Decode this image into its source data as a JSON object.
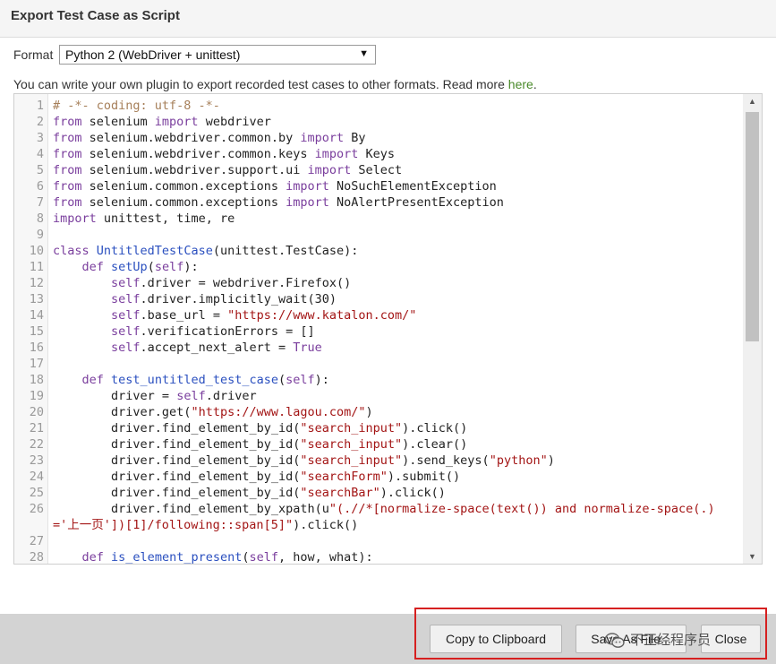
{
  "window": {
    "title": "Export Test Case as Script"
  },
  "format": {
    "label": "Format",
    "selected": "Python 2 (WebDriver + unittest)"
  },
  "info": {
    "text": "You can write your own plugin to export recorded test cases to other formats. Read more ",
    "link": "here",
    "suffix": "."
  },
  "code_lines": [
    {
      "n": "1",
      "text": "# -*- coding: utf-8 -*-"
    },
    {
      "n": "2",
      "text": "from selenium import webdriver"
    },
    {
      "n": "3",
      "text": "from selenium.webdriver.common.by import By"
    },
    {
      "n": "4",
      "text": "from selenium.webdriver.common.keys import Keys"
    },
    {
      "n": "5",
      "text": "from selenium.webdriver.support.ui import Select"
    },
    {
      "n": "6",
      "text": "from selenium.common.exceptions import NoSuchElementException"
    },
    {
      "n": "7",
      "text": "from selenium.common.exceptions import NoAlertPresentException"
    },
    {
      "n": "8",
      "text": "import unittest, time, re"
    },
    {
      "n": "9",
      "text": ""
    },
    {
      "n": "10",
      "text": "class UntitledTestCase(unittest.TestCase):"
    },
    {
      "n": "11",
      "text": "    def setUp(self):"
    },
    {
      "n": "12",
      "text": "        self.driver = webdriver.Firefox()"
    },
    {
      "n": "13",
      "text": "        self.driver.implicitly_wait(30)"
    },
    {
      "n": "14",
      "text": "        self.base_url = \"https://www.katalon.com/\""
    },
    {
      "n": "15",
      "text": "        self.verificationErrors = []"
    },
    {
      "n": "16",
      "text": "        self.accept_next_alert = True"
    },
    {
      "n": "17",
      "text": ""
    },
    {
      "n": "18",
      "text": "    def test_untitled_test_case(self):"
    },
    {
      "n": "19",
      "text": "        driver = self.driver"
    },
    {
      "n": "20",
      "text": "        driver.get(\"https://www.lagou.com/\")"
    },
    {
      "n": "21",
      "text": "        driver.find_element_by_id(\"search_input\").click()"
    },
    {
      "n": "22",
      "text": "        driver.find_element_by_id(\"search_input\").clear()"
    },
    {
      "n": "23",
      "text": "        driver.find_element_by_id(\"search_input\").send_keys(\"python\")"
    },
    {
      "n": "24",
      "text": "        driver.find_element_by_id(\"searchForm\").submit()"
    },
    {
      "n": "25",
      "text": "        driver.find_element_by_id(\"searchBar\").click()"
    },
    {
      "n": "26",
      "text": "        driver.find_element_by_xpath(u\"(.//*[normalize-space(text()) and normalize-space(.)='上一页'])[1]/following::span[5]\").click()"
    },
    {
      "n": "27",
      "text": ""
    },
    {
      "n": "28",
      "text": "    def is_element_present(self, how, what):"
    }
  ],
  "buttons": {
    "copy": "Copy to Clipboard",
    "save": "Save As File...",
    "close": "Close"
  },
  "watermark": "不正经程序员",
  "icons": {
    "dropdown": "triangle-down-icon",
    "scroll_up": "triangle-up-icon",
    "scroll_down": "triangle-down-icon",
    "watermark": "wechat-icon"
  },
  "colors": {
    "keyword": "#7a3e9d",
    "string": "#a31515",
    "comment": "#a67f59",
    "func": "#2a4fbf",
    "link": "#4a8a2a",
    "highlight": "#d62020"
  }
}
